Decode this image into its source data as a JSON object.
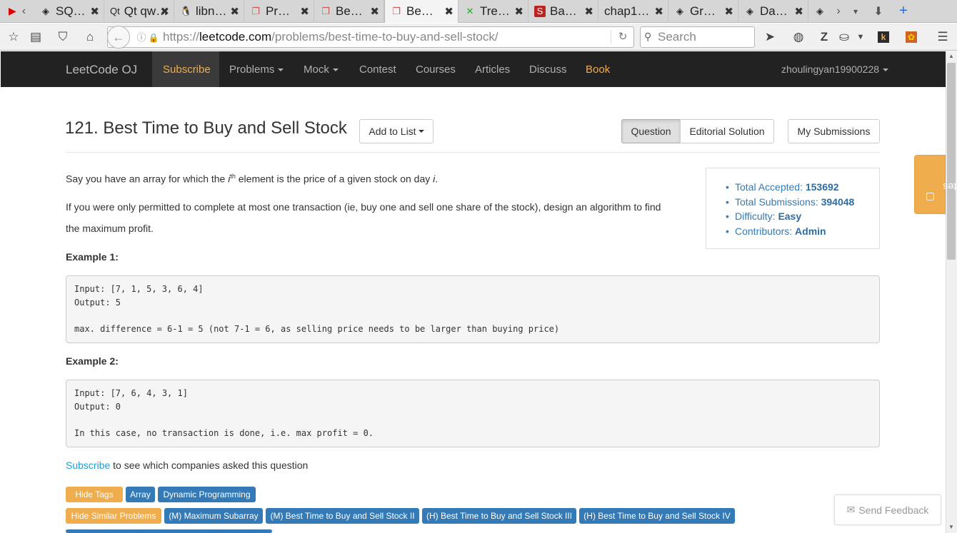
{
  "browser": {
    "tabs": [
      {
        "label": "SQ…",
        "icon": "diamond-icon"
      },
      {
        "label": "Qt qw…",
        "icon": "qt-icon"
      },
      {
        "label": "libn…",
        "icon": "tux-icon"
      },
      {
        "label": "Pr…",
        "icon": "leetcode-icon"
      },
      {
        "label": "Be…",
        "icon": "leetcode-icon"
      },
      {
        "label": "Be…",
        "icon": "leetcode-icon"
      },
      {
        "label": "Tre…",
        "icon": "x-icon"
      },
      {
        "label": "Ba…",
        "icon": "s-icon"
      },
      {
        "label": "chap1…",
        "icon": ""
      },
      {
        "label": "Gr…",
        "icon": "diamond-icon"
      },
      {
        "label": "Da…",
        "icon": "diamond-icon"
      }
    ],
    "url_prefix": "https://",
    "url_domain": "leetcode.com",
    "url_path": "/problems/best-time-to-buy-and-sell-stock/",
    "search_placeholder": "Search"
  },
  "header": {
    "brand": "LeetCode OJ",
    "nav": {
      "subscribe": "Subscribe",
      "problems": "Problems",
      "mock": "Mock",
      "contest": "Contest",
      "courses": "Courses",
      "articles": "Articles",
      "discuss": "Discuss",
      "book": "Book"
    },
    "user": "zhoulingyan19900228"
  },
  "problem": {
    "title": "121. Best Time to Buy and Sell Stock",
    "add_to_list": "Add to List",
    "tab_question": "Question",
    "tab_editorial": "Editorial Solution",
    "my_submissions": "My Submissions",
    "desc1_a": "Say you have an array for which the ",
    "desc1_i": "i",
    "desc1_th": "th",
    "desc1_b": " element is the price of a given stock on day ",
    "desc1_c": "i",
    "desc1_d": ".",
    "desc2_line1": "If you were only permitted to complete at most one transaction (ie, buy one and sell one share of the stock), design an algorithm to find",
    "desc2_line2": "the maximum profit.",
    "example1_heading": "Example 1:",
    "example1": [
      "Input: [7, 1, 5, 3, 6, 4]",
      "Output: 5",
      "",
      "max. difference = 6-1 = 5 (not 7-1 = 6, as selling price needs to be larger than buying price)"
    ],
    "example2_heading": "Example 2:",
    "example2": [
      "Input: [7, 6, 4, 3, 1]",
      "Output: 0",
      "",
      "In this case, no transaction is done, i.e. max profit = 0."
    ],
    "subscribe_link": "Subscribe",
    "subscribe_rest": " to see which companies asked this question"
  },
  "stats": {
    "accepted_label": "Total Accepted: ",
    "accepted_value": "153692",
    "submissions_label": "Total Submissions: ",
    "submissions_value": "394048",
    "difficulty_label": "Difficulty: ",
    "difficulty_value": "Easy",
    "contributors_label": "Contributors: ",
    "contributors_value": "Admin"
  },
  "tags": {
    "hide_tags": "Hide Tags",
    "tag1": "Array",
    "tag2": "Dynamic Programming",
    "hide_similar": "Hide Similar Problems",
    "sim1": "(M) Maximum Subarray",
    "sim2": "(M) Best Time to Buy and Sell Stock II",
    "sim3": "(H) Best Time to Buy and Sell Stock III",
    "sim4": "(H) Best Time to Buy and Sell Stock IV"
  },
  "notes_label": "Notes",
  "feedback_label": "Send Feedback",
  "colors": {
    "accent": "#f0ad4e",
    "link": "#337ab7",
    "header_bg": "#222222"
  }
}
